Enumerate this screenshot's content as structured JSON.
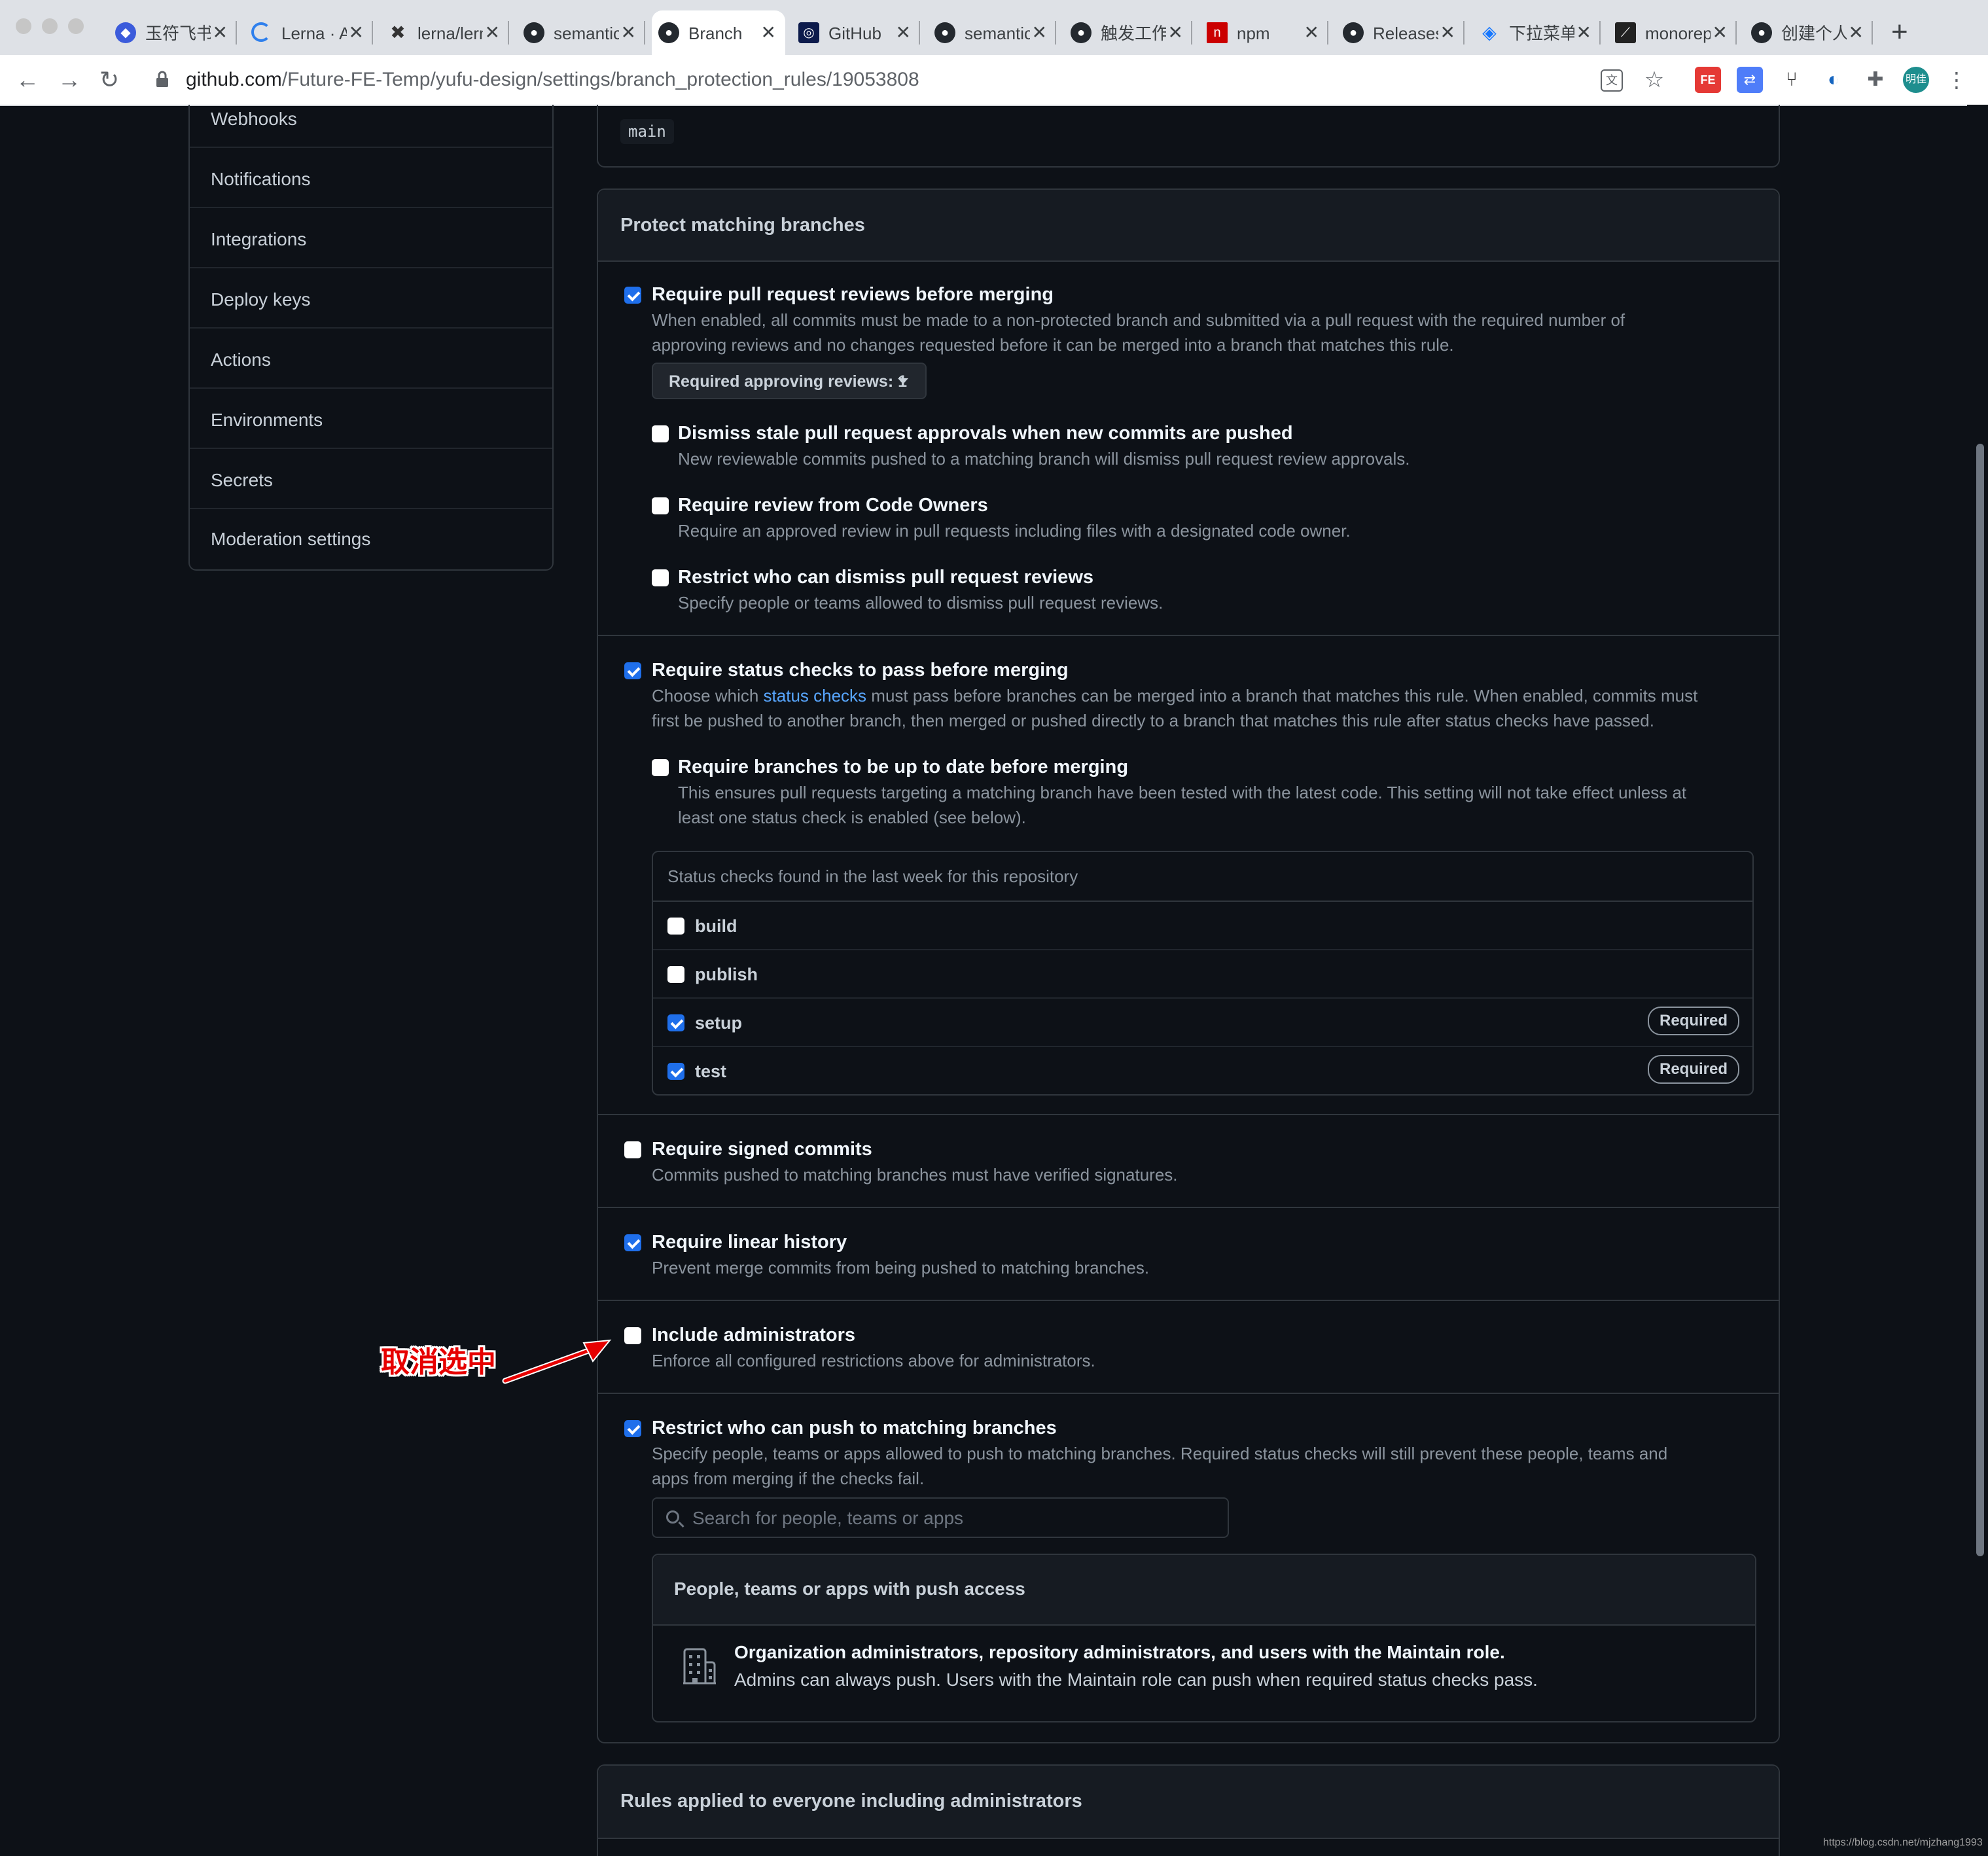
{
  "browser": {
    "tabs": [
      {
        "title": "玉符飞书",
        "icon": "app-logo-icon"
      },
      {
        "title": "Lerna · A",
        "icon": "loading-icon"
      },
      {
        "title": "lerna/lerna",
        "icon": "lerna-icon"
      },
      {
        "title": "semantic",
        "icon": "github-icon"
      },
      {
        "title": "Branch",
        "icon": "github-icon",
        "active": true
      },
      {
        "title": "GitHub",
        "icon": "github-dark-icon"
      },
      {
        "title": "semantic",
        "icon": "github-icon"
      },
      {
        "title": "触发工作",
        "icon": "github-icon"
      },
      {
        "title": "npm",
        "icon": "npm-icon"
      },
      {
        "title": "Releases",
        "icon": "github-icon"
      },
      {
        "title": "下拉菜单",
        "icon": "diamond-icon"
      },
      {
        "title": "monorepo",
        "icon": "chart-icon"
      },
      {
        "title": "创建个人",
        "icon": "github-icon"
      }
    ],
    "url_host": "github.com",
    "url_path": "/Future-FE-Temp/yufu-design/settings/branch_protection_rules/19053808",
    "profile_label": "明佳"
  },
  "sidebar": {
    "items": [
      {
        "label": "Webhooks"
      },
      {
        "label": "Notifications"
      },
      {
        "label": "Integrations"
      },
      {
        "label": "Deploy keys"
      },
      {
        "label": "Actions"
      },
      {
        "label": "Environments"
      },
      {
        "label": "Secrets"
      },
      {
        "label": "Moderation settings"
      }
    ]
  },
  "branch_pattern": "main",
  "protect": {
    "heading": "Protect matching branches",
    "pr_reviews": {
      "title": "Require pull request reviews before merging",
      "desc_line1": "When enabled, all commits must be made to a non-protected branch and submitted via a pull request with the required number of",
      "desc_line2": "approving reviews and no changes requested before it can be merged into a branch that matches this rule.",
      "checked": true,
      "reviews_button": "Required approving reviews: 1"
    },
    "dismiss_stale": {
      "title": "Dismiss stale pull request approvals when new commits are pushed",
      "desc": "New reviewable commits pushed to a matching branch will dismiss pull request review approvals.",
      "checked": false
    },
    "code_owners": {
      "title": "Require review from Code Owners",
      "desc": "Require an approved review in pull requests including files with a designated code owner.",
      "checked": false
    },
    "restrict_dismiss": {
      "title": "Restrict who can dismiss pull request reviews",
      "desc": "Specify people or teams allowed to dismiss pull request reviews.",
      "checked": false
    },
    "status_checks": {
      "title": "Require status checks to pass before merging",
      "desc_before_link": "Choose which ",
      "desc_link": "status checks",
      "desc_after_link": " must pass before branches can be merged into a branch that matches this rule. When enabled, commits must",
      "desc_line2": "first be pushed to another branch, then merged or pushed directly to a branch that matches this rule after status checks have passed.",
      "checked": true
    },
    "up_to_date": {
      "title": "Require branches to be up to date before merging",
      "desc_line1": "This ensures pull requests targeting a matching branch have been tested with the latest code. This setting will not take effect unless at",
      "desc_line2": "least one status check is enabled (see below).",
      "checked": false
    },
    "status_list": {
      "header": "Status checks found in the last week for this repository",
      "rows": [
        {
          "name": "build",
          "checked": false,
          "badge": ""
        },
        {
          "name": "publish",
          "checked": false,
          "badge": ""
        },
        {
          "name": "setup",
          "checked": true,
          "badge": "Required"
        },
        {
          "name": "test",
          "checked": true,
          "badge": "Required"
        }
      ]
    },
    "signed_commits": {
      "title": "Require signed commits",
      "desc": "Commits pushed to matching branches must have verified signatures.",
      "checked": false
    },
    "linear_history": {
      "title": "Require linear history",
      "desc": "Prevent merge commits from being pushed to matching branches.",
      "checked": true
    },
    "include_admins": {
      "title": "Include administrators",
      "desc": "Enforce all configured restrictions above for administrators.",
      "checked": false
    },
    "restrict_push": {
      "title": "Restrict who can push to matching branches",
      "desc_line1": "Specify people, teams or apps allowed to push to matching branches. Required status checks will still prevent these people, teams and",
      "desc_line2": "apps from merging if the checks fail.",
      "checked": true,
      "search_placeholder": "Search for people, teams or apps"
    },
    "push_access": {
      "heading": "People, teams or apps with push access",
      "org_title": "Organization administrators, repository administrators, and users with the Maintain role.",
      "org_desc": "Admins can always push. Users with the Maintain role can push when required status checks pass."
    }
  },
  "rules_everyone": {
    "heading": "Rules applied to everyone including administrators"
  },
  "annotation": {
    "text": "取消选中",
    "color": "#e60000"
  },
  "watermark": "https://blog.csdn.net/mjzhang1993",
  "colors": {
    "accent": "#1f6feb",
    "link": "#58a6ff",
    "background": "#0d1117"
  }
}
